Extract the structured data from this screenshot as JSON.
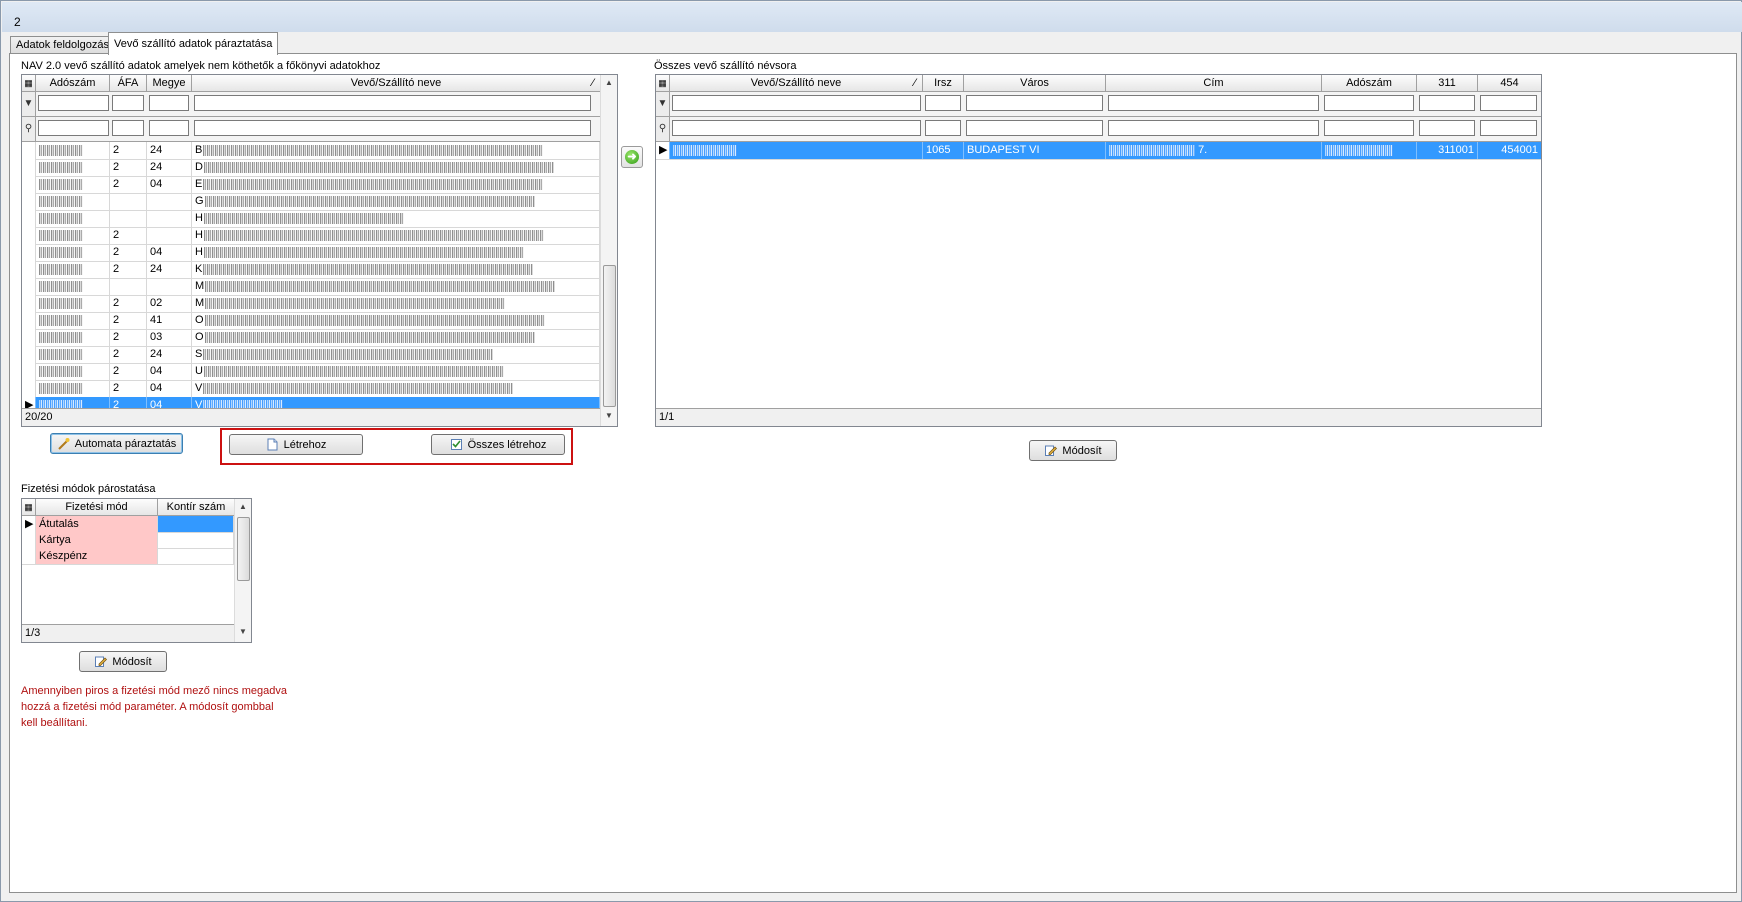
{
  "window": {
    "title": "2"
  },
  "tabs": [
    {
      "label": "Adatok feldolgozása",
      "active": false
    },
    {
      "label": "Vevő szállító adatok páraztatása",
      "active": true
    }
  ],
  "left_grid": {
    "caption": "NAV 2.0 vevő szállító adatok amelyek nem köthetők a főkönyvi adatokhoz",
    "columns": [
      "Adószám",
      "ÁFA",
      "Megye",
      "Vevő/Szállító neve"
    ],
    "rows": [
      {
        "afa": "2",
        "megye": "24",
        "name_initial": "B"
      },
      {
        "afa": "2",
        "megye": "24",
        "name_initial": "D"
      },
      {
        "afa": "2",
        "megye": "04",
        "name_initial": "E"
      },
      {
        "afa": "",
        "megye": "",
        "name_initial": "G"
      },
      {
        "afa": "",
        "megye": "",
        "name_initial": "H"
      },
      {
        "afa": "2",
        "megye": "",
        "name_initial": "H"
      },
      {
        "afa": "2",
        "megye": "04",
        "name_initial": "H"
      },
      {
        "afa": "2",
        "megye": "24",
        "name_initial": "K"
      },
      {
        "afa": "",
        "megye": "",
        "name_initial": "M"
      },
      {
        "afa": "2",
        "megye": "02",
        "name_initial": "M"
      },
      {
        "afa": "2",
        "megye": "41",
        "name_initial": "O"
      },
      {
        "afa": "2",
        "megye": "03",
        "name_initial": "O"
      },
      {
        "afa": "2",
        "megye": "24",
        "name_initial": "S"
      },
      {
        "afa": "2",
        "megye": "04",
        "name_initial": "U"
      },
      {
        "afa": "2",
        "megye": "04",
        "name_initial": "V"
      },
      {
        "afa": "2",
        "megye": "04",
        "name_initial": "V"
      }
    ],
    "selected_index": 15,
    "footer": "20/20"
  },
  "right_grid": {
    "caption": "Összes vevő szállító névsora",
    "columns": [
      "Vevő/Szállító neve",
      "Irsz",
      "Város",
      "Cím",
      "Adószám",
      "311",
      "454"
    ],
    "rows": [
      {
        "irsz": "1065",
        "varos": "BUDAPEST VI",
        "cim_suffix": "7.",
        "c311": "311001",
        "c454": "454001"
      }
    ],
    "footer": "1/1"
  },
  "buttons": {
    "auto": "Automata páraztatás",
    "create": "Létrehoz",
    "create_all": "Összes létrehoz",
    "modify_right": "Módosít",
    "modify_bottom": "Módosít"
  },
  "payment": {
    "caption": "Fizetési módok párostatása",
    "columns": [
      "Fizetési mód",
      "Kontír szám"
    ],
    "rows": [
      {
        "mode": "Átutalás",
        "kontir": ""
      },
      {
        "mode": "Kártya",
        "kontir": ""
      },
      {
        "mode": "Készpénz",
        "kontir": ""
      }
    ],
    "footer": "1/3"
  },
  "note": {
    "line1": "Amennyiben piros a fizetési mód mező nincs megadva",
    "line2": "hozzá a fizetési mód paraméter. A módosít gombbal",
    "line3": "kell beállítani."
  },
  "colors": {
    "selection": "#3399ff",
    "warning": "#b01010",
    "unmapped": "#ffc8c8",
    "highlight_box": "#cc1111"
  }
}
